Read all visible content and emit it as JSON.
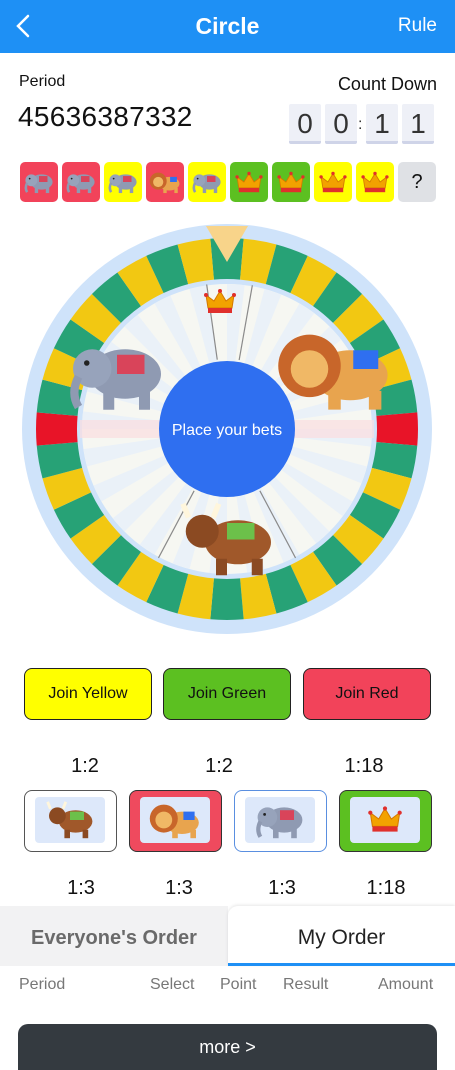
{
  "header": {
    "title": "Circle",
    "rule_label": "Rule",
    "back_icon": "chevron-left-icon"
  },
  "period": {
    "label": "Period",
    "value": "45636387332"
  },
  "countdown": {
    "label": "Count Down",
    "digits": [
      "0",
      "0",
      "1",
      "1"
    ],
    "separator": ":"
  },
  "history": {
    "items": [
      {
        "animal": "elephant",
        "color": "red"
      },
      {
        "animal": "elephant",
        "color": "red"
      },
      {
        "animal": "elephant",
        "color": "yellow"
      },
      {
        "animal": "lion",
        "color": "red"
      },
      {
        "animal": "elephant",
        "color": "yellow"
      },
      {
        "animal": "crown",
        "color": "green"
      },
      {
        "animal": "crown",
        "color": "green"
      },
      {
        "animal": "crown",
        "color": "yellow"
      },
      {
        "animal": "crown",
        "color": "yellow"
      }
    ],
    "unknown_label": "?"
  },
  "wheel": {
    "center_label": "Place your bets"
  },
  "join_buttons": [
    {
      "label": "Join Yellow",
      "color": "#ffff00"
    },
    {
      "label": "Join Green",
      "color": "#5cc021"
    },
    {
      "label": "Join Red",
      "color": "#f2435a"
    }
  ],
  "color_odds": [
    "1:2",
    "1:2",
    "1:18"
  ],
  "animal_cards": [
    {
      "animal": "ox"
    },
    {
      "animal": "lion"
    },
    {
      "animal": "elephant"
    },
    {
      "animal": "crown"
    }
  ],
  "animal_odds": [
    "1:3",
    "1:3",
    "1:3",
    "1:18"
  ],
  "tabs": {
    "everyone": "Everyone's Order",
    "mine": "My Order"
  },
  "columns": {
    "period": "Period",
    "select": "Select",
    "point": "Point",
    "result": "Result",
    "amount": "Amount"
  },
  "more_label": "more >",
  "colors": {
    "accent": "#1e90f5",
    "yellow": "#ffff00",
    "green": "#5cc021",
    "red": "#f2435a",
    "wheel_green": "#27a276",
    "wheel_yellow": "#f2c812",
    "wheel_red": "#e81428",
    "center_blue": "#2f6ff0"
  }
}
